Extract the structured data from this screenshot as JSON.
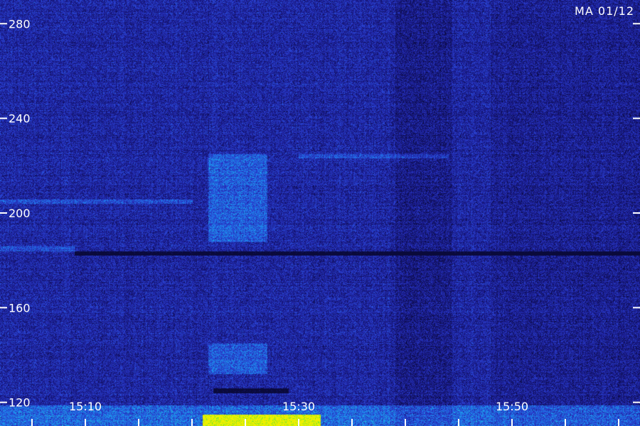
{
  "station_label": "MA 01/12",
  "chart_data": {
    "type": "heatmap",
    "title": "",
    "xlabel": "",
    "ylabel": "",
    "ylim": [
      110,
      290
    ],
    "xlim": [
      "15:02",
      "15:62"
    ],
    "y_ticks": [
      120,
      160,
      200,
      240,
      280
    ],
    "x_tick_labels": [
      {
        "label": "15:10",
        "t": 10
      },
      {
        "label": "15:30",
        "t": 30
      },
      {
        "label": "15:50",
        "t": 50
      }
    ],
    "x_minor_step_minutes": 5,
    "colormap": [
      "#0a0a3a",
      "#1a1a8c",
      "#2a3fd0",
      "#1c8cf0",
      "#20d0d0",
      "#40e040",
      "#f0f000"
    ],
    "features": [
      {
        "kind": "dark_band",
        "y_value": 183,
        "t_start": 9,
        "t_end": 62
      },
      {
        "kind": "dark_band",
        "y_value": 125,
        "t_start": 22,
        "t_end": 29
      },
      {
        "kind": "bright_region",
        "t_start": 21.5,
        "t_end": 27,
        "y_min": 188,
        "y_max": 225
      },
      {
        "kind": "bright_region",
        "t_start": 21.5,
        "t_end": 27,
        "y_min": 132,
        "y_max": 145
      },
      {
        "kind": "bright_line",
        "y_value": 224,
        "t_start": 30,
        "t_end": 44
      },
      {
        "kind": "bright_line",
        "y_value": 205,
        "t_start": 2,
        "t_end": 20
      },
      {
        "kind": "bright_line",
        "y_value": 185,
        "t_start": 2,
        "t_end": 9
      },
      {
        "kind": "hot_band",
        "y_min": 110,
        "y_max": 115,
        "t_start": 21,
        "t_end": 32
      }
    ]
  }
}
